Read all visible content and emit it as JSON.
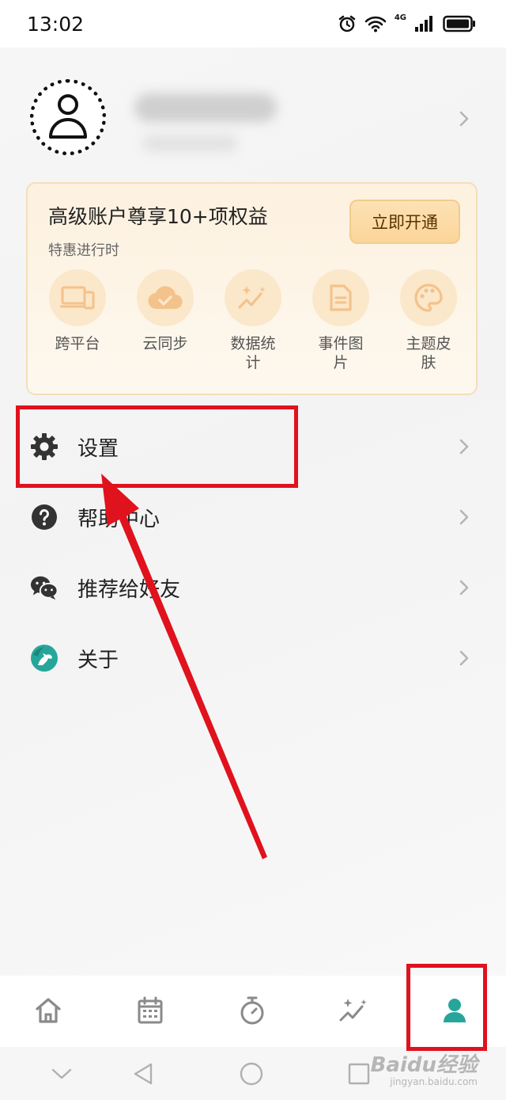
{
  "status_bar": {
    "time": "13:02",
    "network": "4G",
    "icons": [
      "alarm-icon",
      "wifi-icon",
      "signal-icon",
      "battery-icon"
    ]
  },
  "profile": {
    "avatar_icon": "person-icon"
  },
  "premium": {
    "title": "高级账户尊享10+项权益",
    "subtitle": "特惠进行时",
    "button_label": "立即开通",
    "benefits": [
      {
        "label": "跨平台",
        "icon": "devices-icon"
      },
      {
        "label": "云同步",
        "icon": "cloud-check-icon"
      },
      {
        "label": "数据统计",
        "icon": "sparkle-chart-icon"
      },
      {
        "label": "事件图片",
        "icon": "document-icon"
      },
      {
        "label": "主题皮肤",
        "icon": "palette-icon"
      }
    ]
  },
  "menu": {
    "items": [
      {
        "label": "设置",
        "icon": "gear-icon"
      },
      {
        "label": "帮助中心",
        "icon": "help-icon"
      },
      {
        "label": "推荐给好友",
        "icon": "wechat-icon"
      },
      {
        "label": "关于",
        "icon": "app-logo-icon"
      }
    ]
  },
  "bottom_nav": {
    "items": [
      "home-icon",
      "calendar-icon",
      "timer-icon",
      "stats-icon",
      "profile-icon"
    ],
    "active": "profile-icon"
  },
  "watermark": {
    "brand": "Baidu经验",
    "url": "jingyan.baidu.com"
  },
  "colors": {
    "accent": "#26a69a",
    "annotation": "#e0121d",
    "premium_bg": "#fdf1df",
    "premium_button": "#fbd59a"
  }
}
